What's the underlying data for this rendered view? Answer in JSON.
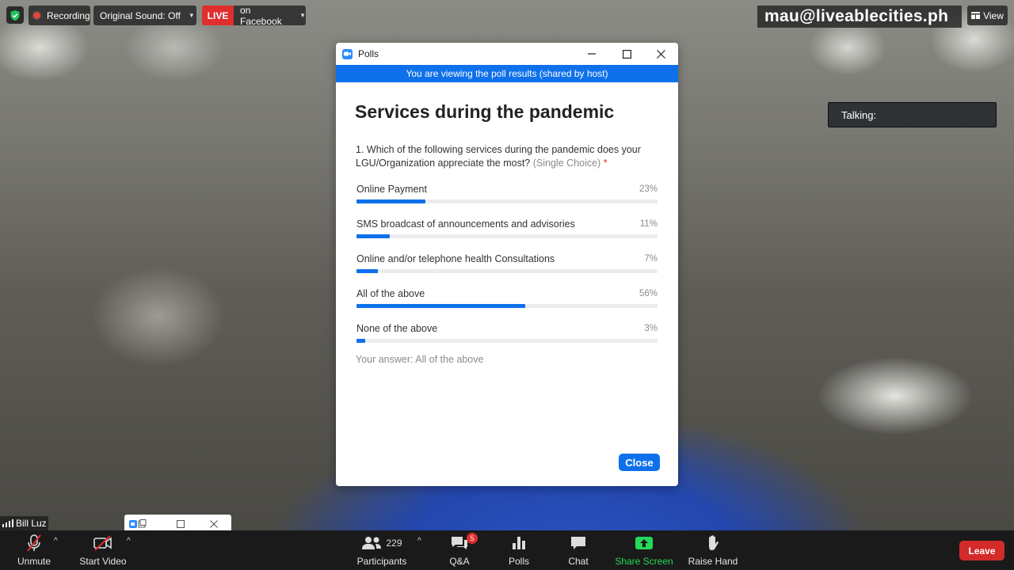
{
  "top_bar": {
    "recording": "Recording",
    "original_sound": "Original Sound: Off",
    "live_badge": "LIVE",
    "live_target": "on Facebook",
    "watermark": "mau@liveablecities.ph",
    "view": "View"
  },
  "talking_indicator": "Talking:",
  "poll_window": {
    "window_title": "Polls",
    "banner": "You are viewing the poll results (shared by host)",
    "poll_title": "Services during the pandemic",
    "question": "1. Which of the following services during the pandemic does your LGU/Organization appreciate the most?",
    "question_hint": "(Single Choice)",
    "required_mark": "*",
    "options": [
      {
        "label": "Online Payment",
        "percent_text": "23%",
        "percent": 23
      },
      {
        "label": "SMS broadcast of announcements and advisories",
        "percent_text": "11%",
        "percent": 11
      },
      {
        "label": "Online and/or telephone health Consultations",
        "percent_text": "7%",
        "percent": 7
      },
      {
        "label": "All of the above",
        "percent_text": "56%",
        "percent": 56
      },
      {
        "label": "None of the above",
        "percent_text": "3%",
        "percent": 3
      }
    ],
    "your_answer": "Your answer: All of the above",
    "close_label": "Close",
    "accent_color": "#0e71eb"
  },
  "self_view": {
    "name": "Bill Luz"
  },
  "toolbar": {
    "unmute": "Unmute",
    "start_video": "Start Video",
    "participants_count": "229",
    "participants": "Participants",
    "qa": "Q&A",
    "qa_badge": "5",
    "polls": "Polls",
    "chat": "Chat",
    "share_screen": "Share Screen",
    "raise_hand": "Raise Hand",
    "leave": "Leave",
    "share_color": "#23d959",
    "leave_color": "#d32a2a"
  }
}
